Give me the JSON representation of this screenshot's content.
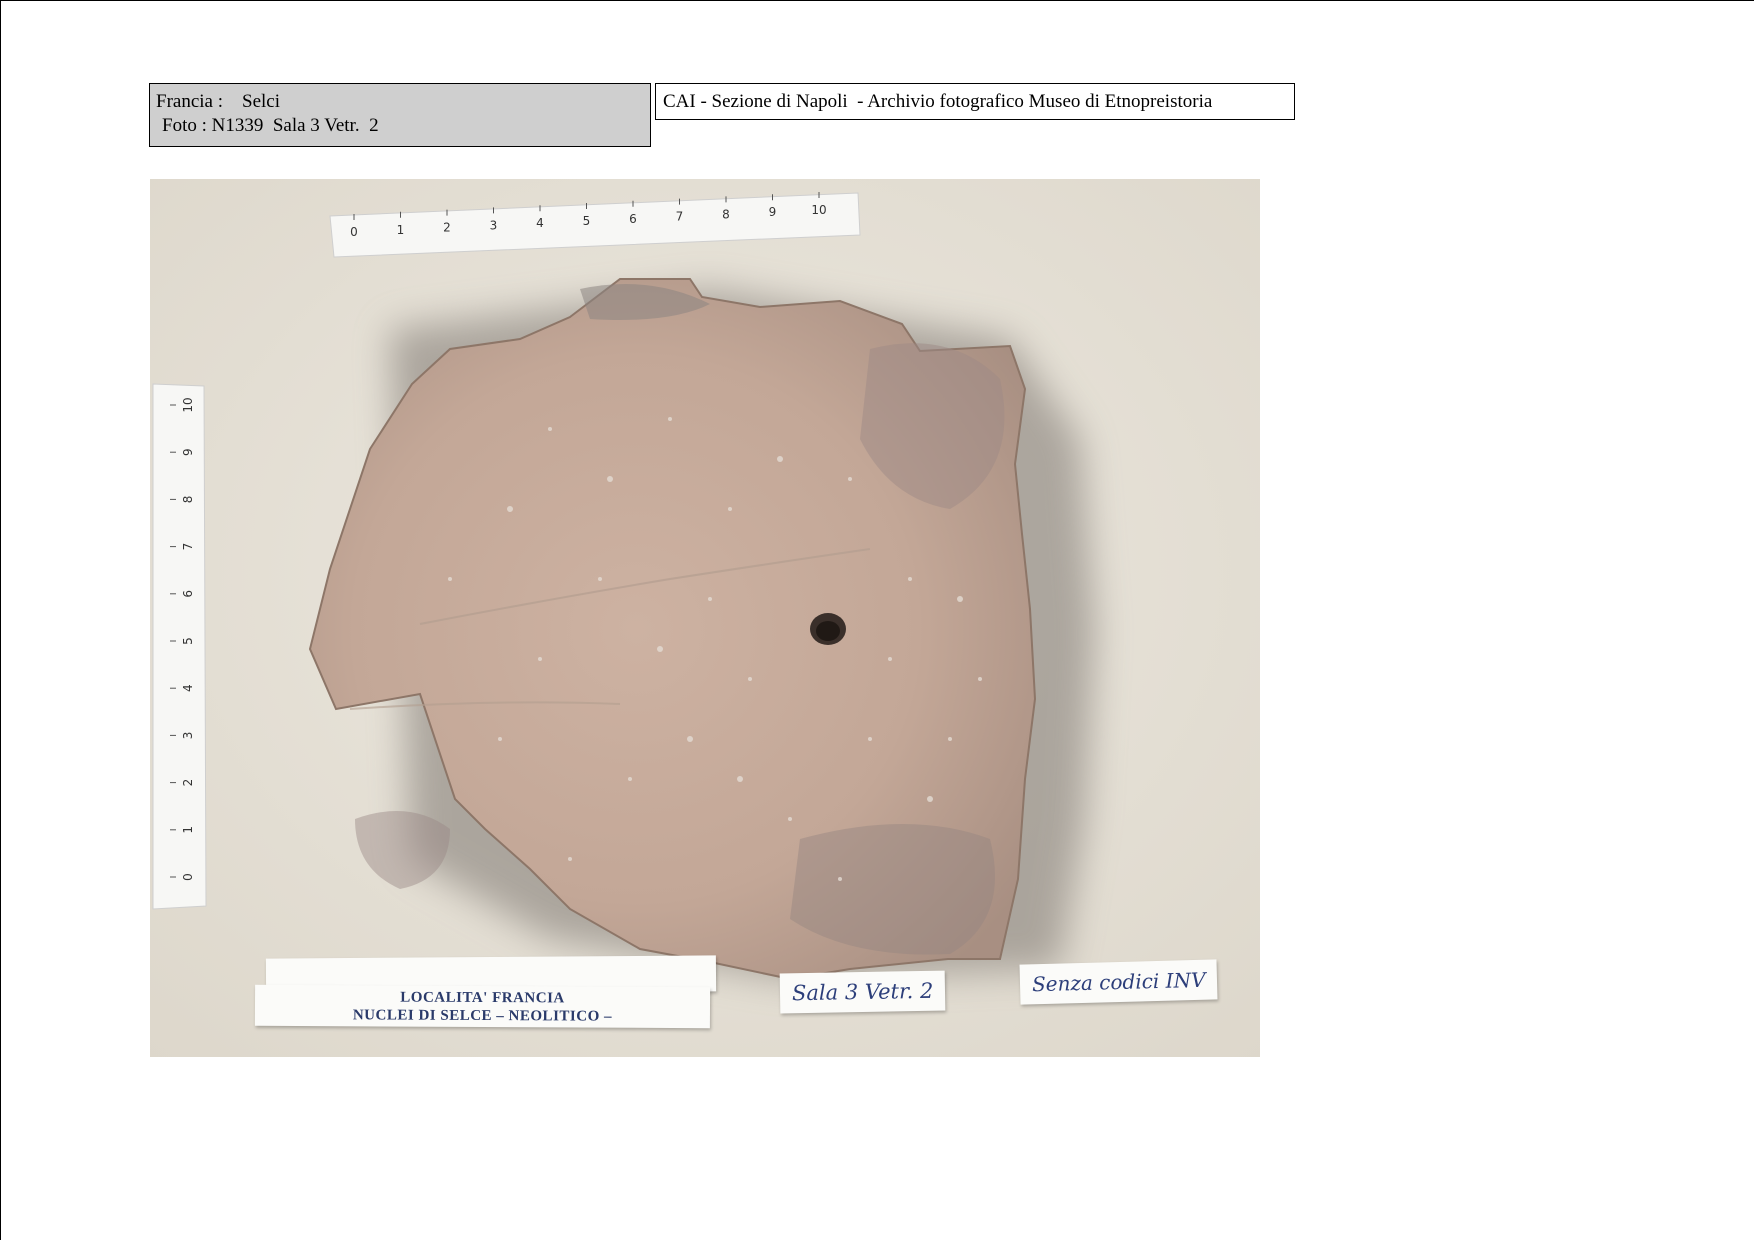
{
  "header": {
    "line1": "Francia :    Selci",
    "line2": "Foto : N1339  Sala 3 Vetr.  2",
    "archive": "CAI - Sezione di Napoli  - Archivio fotografico Museo di Etnopreistoria"
  },
  "photo": {
    "ruler_top_numbers": [
      "0",
      "1",
      "2",
      "3",
      "4",
      "5",
      "6",
      "7",
      "8",
      "9",
      "10"
    ],
    "ruler_left_numbers": [
      "0",
      "1",
      "2",
      "3",
      "4",
      "5",
      "6",
      "7",
      "8",
      "9",
      "10"
    ],
    "label_typed_line1": "LOCALITA' FRANCIA",
    "label_typed_line2": "NUCLEI DI SELCE – NEOLITICO –",
    "label_sala": "Sala 3 Vetr. 2",
    "label_codice": "Senza codici INV"
  }
}
